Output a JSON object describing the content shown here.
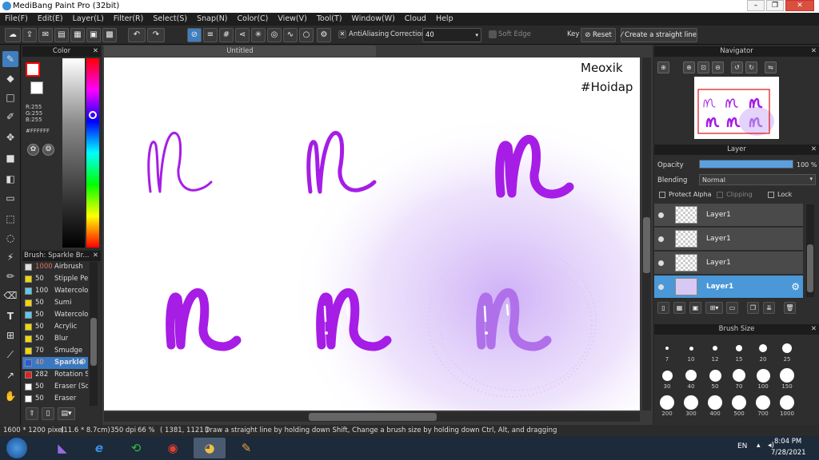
{
  "window": {
    "title": "MediBang Paint Pro (32bit)"
  },
  "menu": [
    "File(F)",
    "Edit(E)",
    "Layer(L)",
    "Filter(R)",
    "Select(S)",
    "Snap(N)",
    "Color(C)",
    "View(V)",
    "Tool(T)",
    "Window(W)",
    "Cloud",
    "Help"
  ],
  "toolbar": {
    "antialiasing_label": "AntiAliasing",
    "correction_label": "Correction",
    "correction_value": "40",
    "soft_edge_label": "Soft Edge",
    "key_label": "Key",
    "reset_label": "Reset",
    "straight_line_label": "Create a straight line"
  },
  "color_panel": {
    "title": "Color",
    "r": "R:255",
    "g": "G:255",
    "b": "B:255",
    "hex": "#FFFFFF",
    "primary_color": "#ff0000",
    "secondary_color": "#ffffff"
  },
  "brush_panel": {
    "title": "Brush: Sparkle Br...",
    "items": [
      {
        "size": "1000",
        "name": "Airbrush",
        "color": "#dddddd"
      },
      {
        "size": "50",
        "name": "Stipple Pe",
        "color": "#f1d600"
      },
      {
        "size": "100",
        "name": "Watercolo",
        "color": "#5bc8f0"
      },
      {
        "size": "50",
        "name": "Sumi",
        "color": "#f1d600"
      },
      {
        "size": "50",
        "name": "Watercolo",
        "color": "#5bc8f0"
      },
      {
        "size": "50",
        "name": "Acrylic",
        "color": "#f1d600"
      },
      {
        "size": "50",
        "name": "Blur",
        "color": "#f1d600"
      },
      {
        "size": "70",
        "name": "Smudge",
        "color": "#f1d600"
      },
      {
        "size": "40",
        "name": "Sparkle",
        "color": "#2a5ad8"
      },
      {
        "size": "282",
        "name": "Rotation S",
        "color": "#e02020"
      },
      {
        "size": "50",
        "name": "Eraser (Sc",
        "color": "#ffffff"
      },
      {
        "size": "50",
        "name": "Eraser",
        "color": "#ffffff"
      }
    ]
  },
  "document": {
    "tab_title": "Untitled"
  },
  "canvas_text": {
    "line1": "Meoxik",
    "line2": "#Hoidap"
  },
  "navigator": {
    "title": "Navigator"
  },
  "layer_panel": {
    "title": "Layer",
    "opacity_label": "Opacity",
    "opacity_value": "100 %",
    "opacity_fraction": 1.0,
    "blending_label": "Blending",
    "blending_value": "Normal",
    "protect_alpha": "Protect Alpha",
    "clipping": "Clipping",
    "lock": "Lock",
    "layers": [
      {
        "name": "Layer1"
      },
      {
        "name": "Layer1"
      },
      {
        "name": "Layer1"
      },
      {
        "name": "Layer1"
      }
    ]
  },
  "brush_size_panel": {
    "title": "Brush Size",
    "sizes": [
      "7",
      "10",
      "12",
      "15",
      "20",
      "25",
      "30",
      "40",
      "50",
      "70",
      "100",
      "150",
      "200",
      "300",
      "400",
      "500",
      "700",
      "1000"
    ]
  },
  "status": {
    "pixels": "1600 * 1200 pixel",
    "physical": "(11.6 * 8.7cm)",
    "dpi": "350 dpi",
    "zoom": "66 %",
    "cursor": "( 1381, 1121 )",
    "hint": "Draw a straight line by holding down Shift, Change a brush size by holding down Ctrl, Alt, and dragging"
  },
  "taskbar": {
    "lang": "EN",
    "time": "8:04 PM",
    "date": "7/28/2021"
  }
}
